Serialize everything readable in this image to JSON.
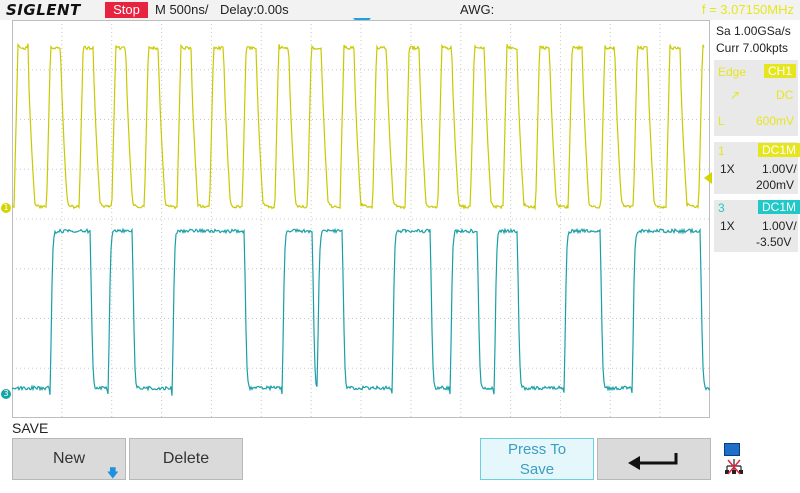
{
  "topbar": {
    "logo": "SIGLENT",
    "run_state": "Stop",
    "timebase": "M 500ns/",
    "delay": "Delay:0.00s",
    "awg": "AWG:",
    "trigger_info": "f = 3.07150MHz"
  },
  "side_panel": {
    "sample_rate": "Sa 1.00GSa/s",
    "memory": "Curr 7.00kpts",
    "trigger": {
      "mode_label": "Edge",
      "source": "CH1",
      "slope_label": "↗",
      "coupling": "DC",
      "level_label": "L",
      "level": "600mV"
    },
    "ch1": {
      "number": "1",
      "coupling": "DC1M",
      "probe": "1X",
      "scale": "1.00V/",
      "offset": "200mV"
    },
    "ch3": {
      "number": "3",
      "coupling": "DC1M",
      "probe": "1X",
      "scale": "1.00V/",
      "offset": "-3.50V"
    }
  },
  "menu": {
    "title": "SAVE",
    "new_label": "New",
    "delete_label": "Delete",
    "press_to_save_line1": "Press To",
    "press_to_save_line2": "Save"
  },
  "colors": {
    "ch1": "#d4d400",
    "ch3": "#14a5a5",
    "stop": "#e8233f",
    "trigger_marker": "#1ea0e6"
  },
  "markers": {
    "ch1": "1",
    "ch3": "3"
  }
}
